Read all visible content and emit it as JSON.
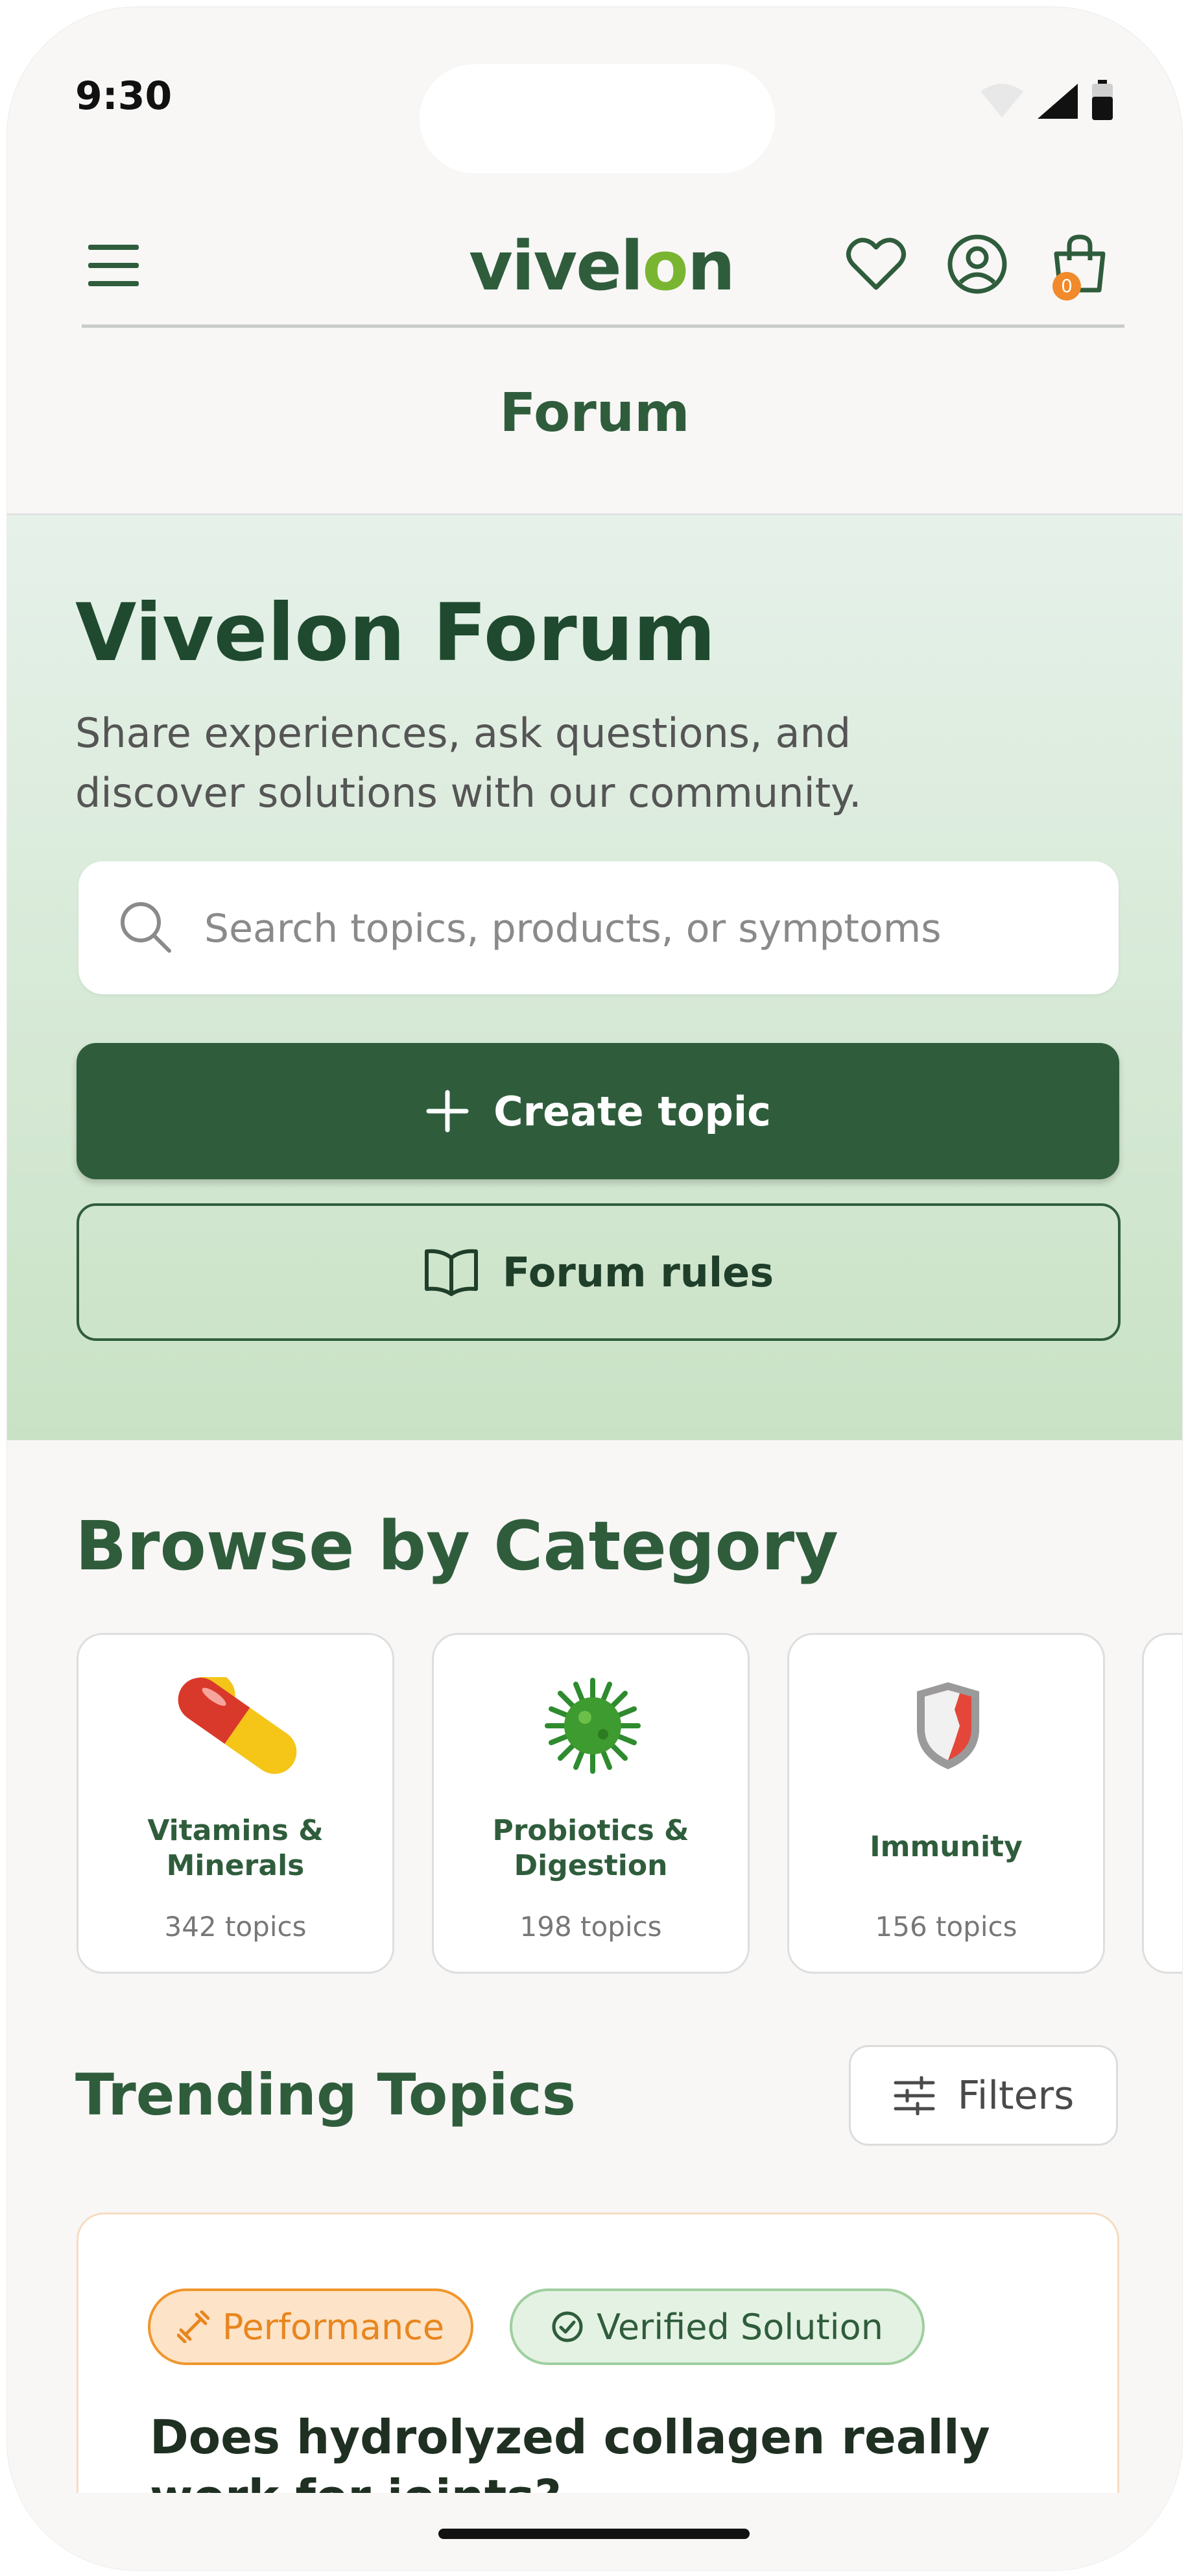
{
  "status_bar": {
    "time": "9:30"
  },
  "header": {
    "logo_prefix": "vivel",
    "logo_leaf": "o",
    "logo_suffix": "n",
    "cart_count": "0",
    "page_title": "Forum"
  },
  "hero": {
    "title": "Vivelon Forum",
    "subtitle": "Share experiences, ask questions, and discover solutions with our community.",
    "search_placeholder": "Search topics, products, or symptoms",
    "create_label": "Create topic",
    "rules_label": "Forum rules"
  },
  "browse": {
    "title": "Browse by Category",
    "categories": [
      {
        "name": "Vitamins & Minerals",
        "count": "342 topics",
        "icon": "pill-icon"
      },
      {
        "name": "Probiotics & Digestion",
        "count": "198 topics",
        "icon": "microbe-icon"
      },
      {
        "name": "Immunity",
        "count": "156 topics",
        "icon": "shield-icon"
      }
    ]
  },
  "trending": {
    "title": "Trending Topics",
    "filters_label": "Filters",
    "topics": [
      {
        "category_badge": "Performance",
        "verified_badge": "Verified Solution",
        "title": "Does hydrolyzed collagen really work for joints?"
      }
    ]
  },
  "colors": {
    "brand_green": "#2f5d3c",
    "leaf_green": "#7ab531",
    "accent_orange": "#f08a2b",
    "background": "#f8f7f6"
  }
}
